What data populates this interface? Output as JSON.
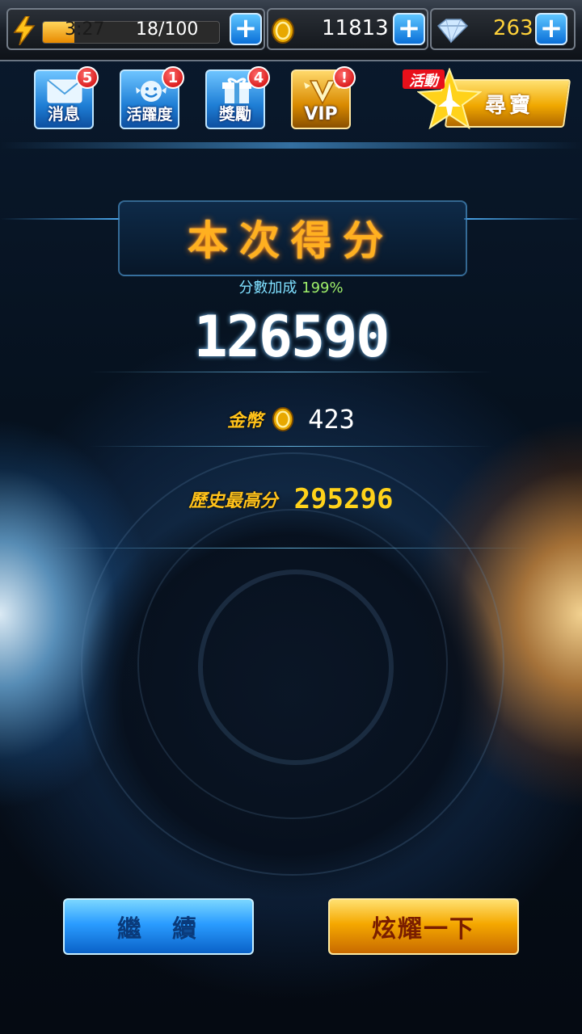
{
  "status": {
    "energy_timer": "3:27",
    "energy_count": "18/100",
    "energy_fill": 0.18,
    "coins": "11813",
    "diamonds": "263",
    "plus_symbol": "+"
  },
  "nav": [
    {
      "label": "消息",
      "badge": "5",
      "icon": "envelope-icon"
    },
    {
      "label": "活躍度",
      "badge": "1",
      "icon": "smiley-wings-icon"
    },
    {
      "label": "獎勵",
      "badge": "4",
      "icon": "gift-icon"
    },
    {
      "label": "VIP",
      "badge": "!",
      "icon": "vip-wings-icon"
    }
  ],
  "event": {
    "tag": "活動",
    "label": "尋寶",
    "icon": "star-jet-icon"
  },
  "result": {
    "title": "本次得分",
    "bonus_label": "分數加成",
    "bonus_value": "199%",
    "score": "126590",
    "coins_label": "金幣",
    "coins_value": "423",
    "best_label": "歷史最高分",
    "best_value": "295296"
  },
  "buttons": {
    "continue": "繼　續",
    "show_off": "炫耀一下"
  },
  "colors": {
    "accent_orange": "#ffb020",
    "accent_blue": "#2a9cff",
    "gold": "#ffc21a"
  }
}
